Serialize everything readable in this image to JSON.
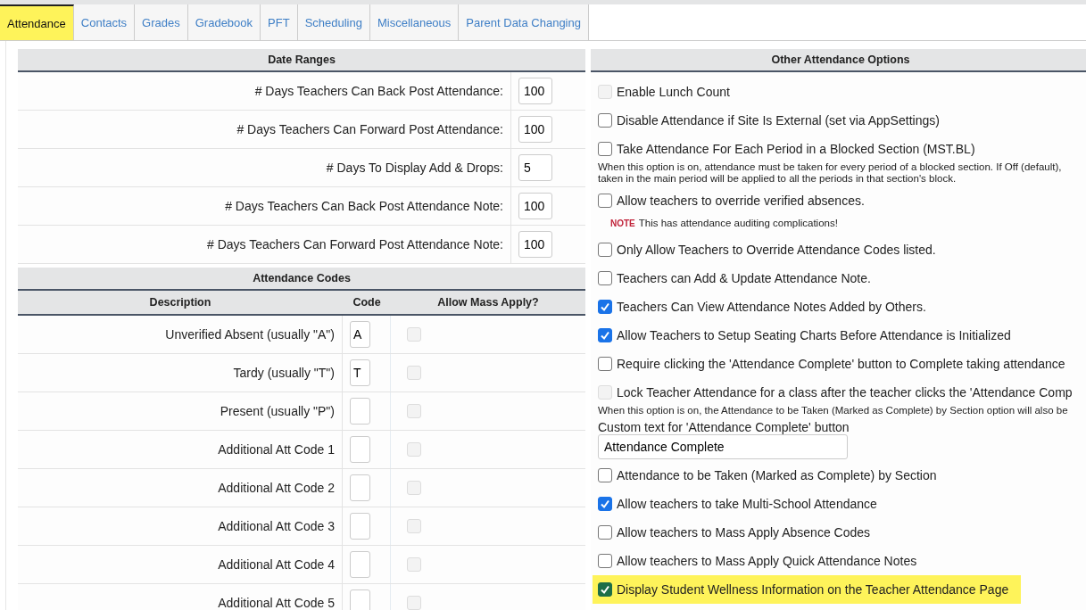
{
  "tabs": [
    {
      "label": "Attendance",
      "selected": true,
      "highlighted": true
    },
    {
      "label": "Contacts",
      "selected": false,
      "highlighted": false
    },
    {
      "label": "Grades",
      "selected": false,
      "highlighted": false
    },
    {
      "label": "Gradebook",
      "selected": false,
      "highlighted": false
    },
    {
      "label": "PFT",
      "selected": false,
      "highlighted": false
    },
    {
      "label": "Scheduling",
      "selected": false,
      "highlighted": false
    },
    {
      "label": "Miscellaneous",
      "selected": false,
      "highlighted": false
    },
    {
      "label": "Parent Data Changing",
      "selected": false,
      "highlighted": false
    }
  ],
  "date_ranges": {
    "title": "Date Ranges",
    "rows": [
      {
        "label": "# Days Teachers Can Back Post Attendance:",
        "value": "100"
      },
      {
        "label": "# Days Teachers Can Forward Post Attendance:",
        "value": "100"
      },
      {
        "label": "# Days To Display Add & Drops:",
        "value": "5"
      },
      {
        "label": "# Days Teachers Can Back Post Attendance Note:",
        "value": "100"
      },
      {
        "label": "# Days Teachers Can Forward Post Attendance Note:",
        "value": "100"
      }
    ]
  },
  "attendance_codes": {
    "title": "Attendance Codes",
    "columns": [
      "Description",
      "Code",
      "Allow Mass Apply?"
    ],
    "rows": [
      {
        "description": "Unverified Absent (usually \"A\")",
        "code": "A",
        "mass_apply": false,
        "disabled": true
      },
      {
        "description": "Tardy (usually \"T\")",
        "code": "T",
        "mass_apply": false,
        "disabled": true
      },
      {
        "description": "Present (usually \"P\")",
        "mass_apply": false,
        "disabled": true
      },
      {
        "description": "Additional Att Code 1",
        "mass_apply": false,
        "disabled": true
      },
      {
        "description": "Additional Att Code 2",
        "mass_apply": false,
        "disabled": true
      },
      {
        "description": "Additional Att Code 3",
        "mass_apply": false,
        "disabled": true
      },
      {
        "description": "Additional Att Code 4",
        "mass_apply": false,
        "disabled": true
      },
      {
        "description": "Additional Att Code 5",
        "mass_apply": false,
        "disabled": true
      }
    ]
  },
  "other_options": {
    "title": "Other Attendance Options",
    "items": [
      {
        "kind": "checkbox",
        "label": "Enable Lunch Count",
        "checked": false,
        "disabled": true,
        "highlighted": false
      },
      {
        "kind": "checkbox",
        "label": "Disable Attendance if Site Is External (set via AppSettings)",
        "checked": false,
        "disabled": false,
        "highlighted": false
      },
      {
        "kind": "checkbox",
        "label": "Take Attendance For Each Period in a Blocked Section (MST.BL)",
        "checked": false,
        "disabled": false,
        "highlighted": false
      },
      {
        "kind": "description",
        "lines": [
          "When this option is on, attendance must be taken for every period of a blocked section. If Off (default),",
          "taken in the main period will be applied to all the periods in that section's block."
        ]
      },
      {
        "kind": "checkbox",
        "label": "Allow teachers to override verified absences.",
        "checked": false,
        "disabled": false,
        "highlighted": false
      },
      {
        "kind": "note",
        "tag": "NOTE",
        "text": "This has attendance auditing complications!"
      },
      {
        "kind": "checkbox",
        "label": "Only Allow Teachers to Override Attendance Codes listed.",
        "checked": false,
        "disabled": false,
        "highlighted": false
      },
      {
        "kind": "checkbox",
        "label": "Teachers can Add & Update Attendance Note.",
        "checked": false,
        "disabled": false,
        "highlighted": false
      },
      {
        "kind": "checkbox",
        "label": "Teachers Can View Attendance Notes Added by Others.",
        "checked": true,
        "disabled": false,
        "highlighted": false
      },
      {
        "kind": "checkbox",
        "label": "Allow Teachers to Setup Seating Charts Before Attendance is Initialized",
        "checked": true,
        "disabled": false,
        "highlighted": false
      },
      {
        "kind": "checkbox",
        "label": "Require clicking the 'Attendance Complete' button to Complete taking attendance",
        "checked": false,
        "disabled": false,
        "highlighted": false
      },
      {
        "kind": "checkbox",
        "label": "Lock Teacher Attendance for a class after the teacher clicks the 'Attendance Comp",
        "checked": false,
        "disabled": true,
        "highlighted": false
      },
      {
        "kind": "description",
        "lines": [
          "When this option is on, the Attendance to be Taken (Marked as Complete) by Section option will also be"
        ]
      },
      {
        "kind": "textfield",
        "label": "Custom text for 'Attendance Complete' button",
        "value": "Attendance Complete"
      },
      {
        "kind": "checkbox",
        "label": "Attendance to be Taken (Marked as Complete) by Section",
        "checked": false,
        "disabled": false,
        "highlighted": false
      },
      {
        "kind": "checkbox",
        "label": "Allow teachers to take Multi-School Attendance",
        "checked": true,
        "disabled": false,
        "highlighted": false
      },
      {
        "kind": "checkbox",
        "label": "Allow teachers to Mass Apply Absence Codes",
        "checked": false,
        "disabled": false,
        "highlighted": false
      },
      {
        "kind": "checkbox",
        "label": "Allow teachers to Mass Apply Quick Attendance Notes",
        "checked": false,
        "disabled": false,
        "highlighted": false
      },
      {
        "kind": "checkbox",
        "label": "Display Student Wellness Information on the Teacher Attendance Page",
        "checked": true,
        "disabled": false,
        "highlighted": true
      }
    ]
  }
}
